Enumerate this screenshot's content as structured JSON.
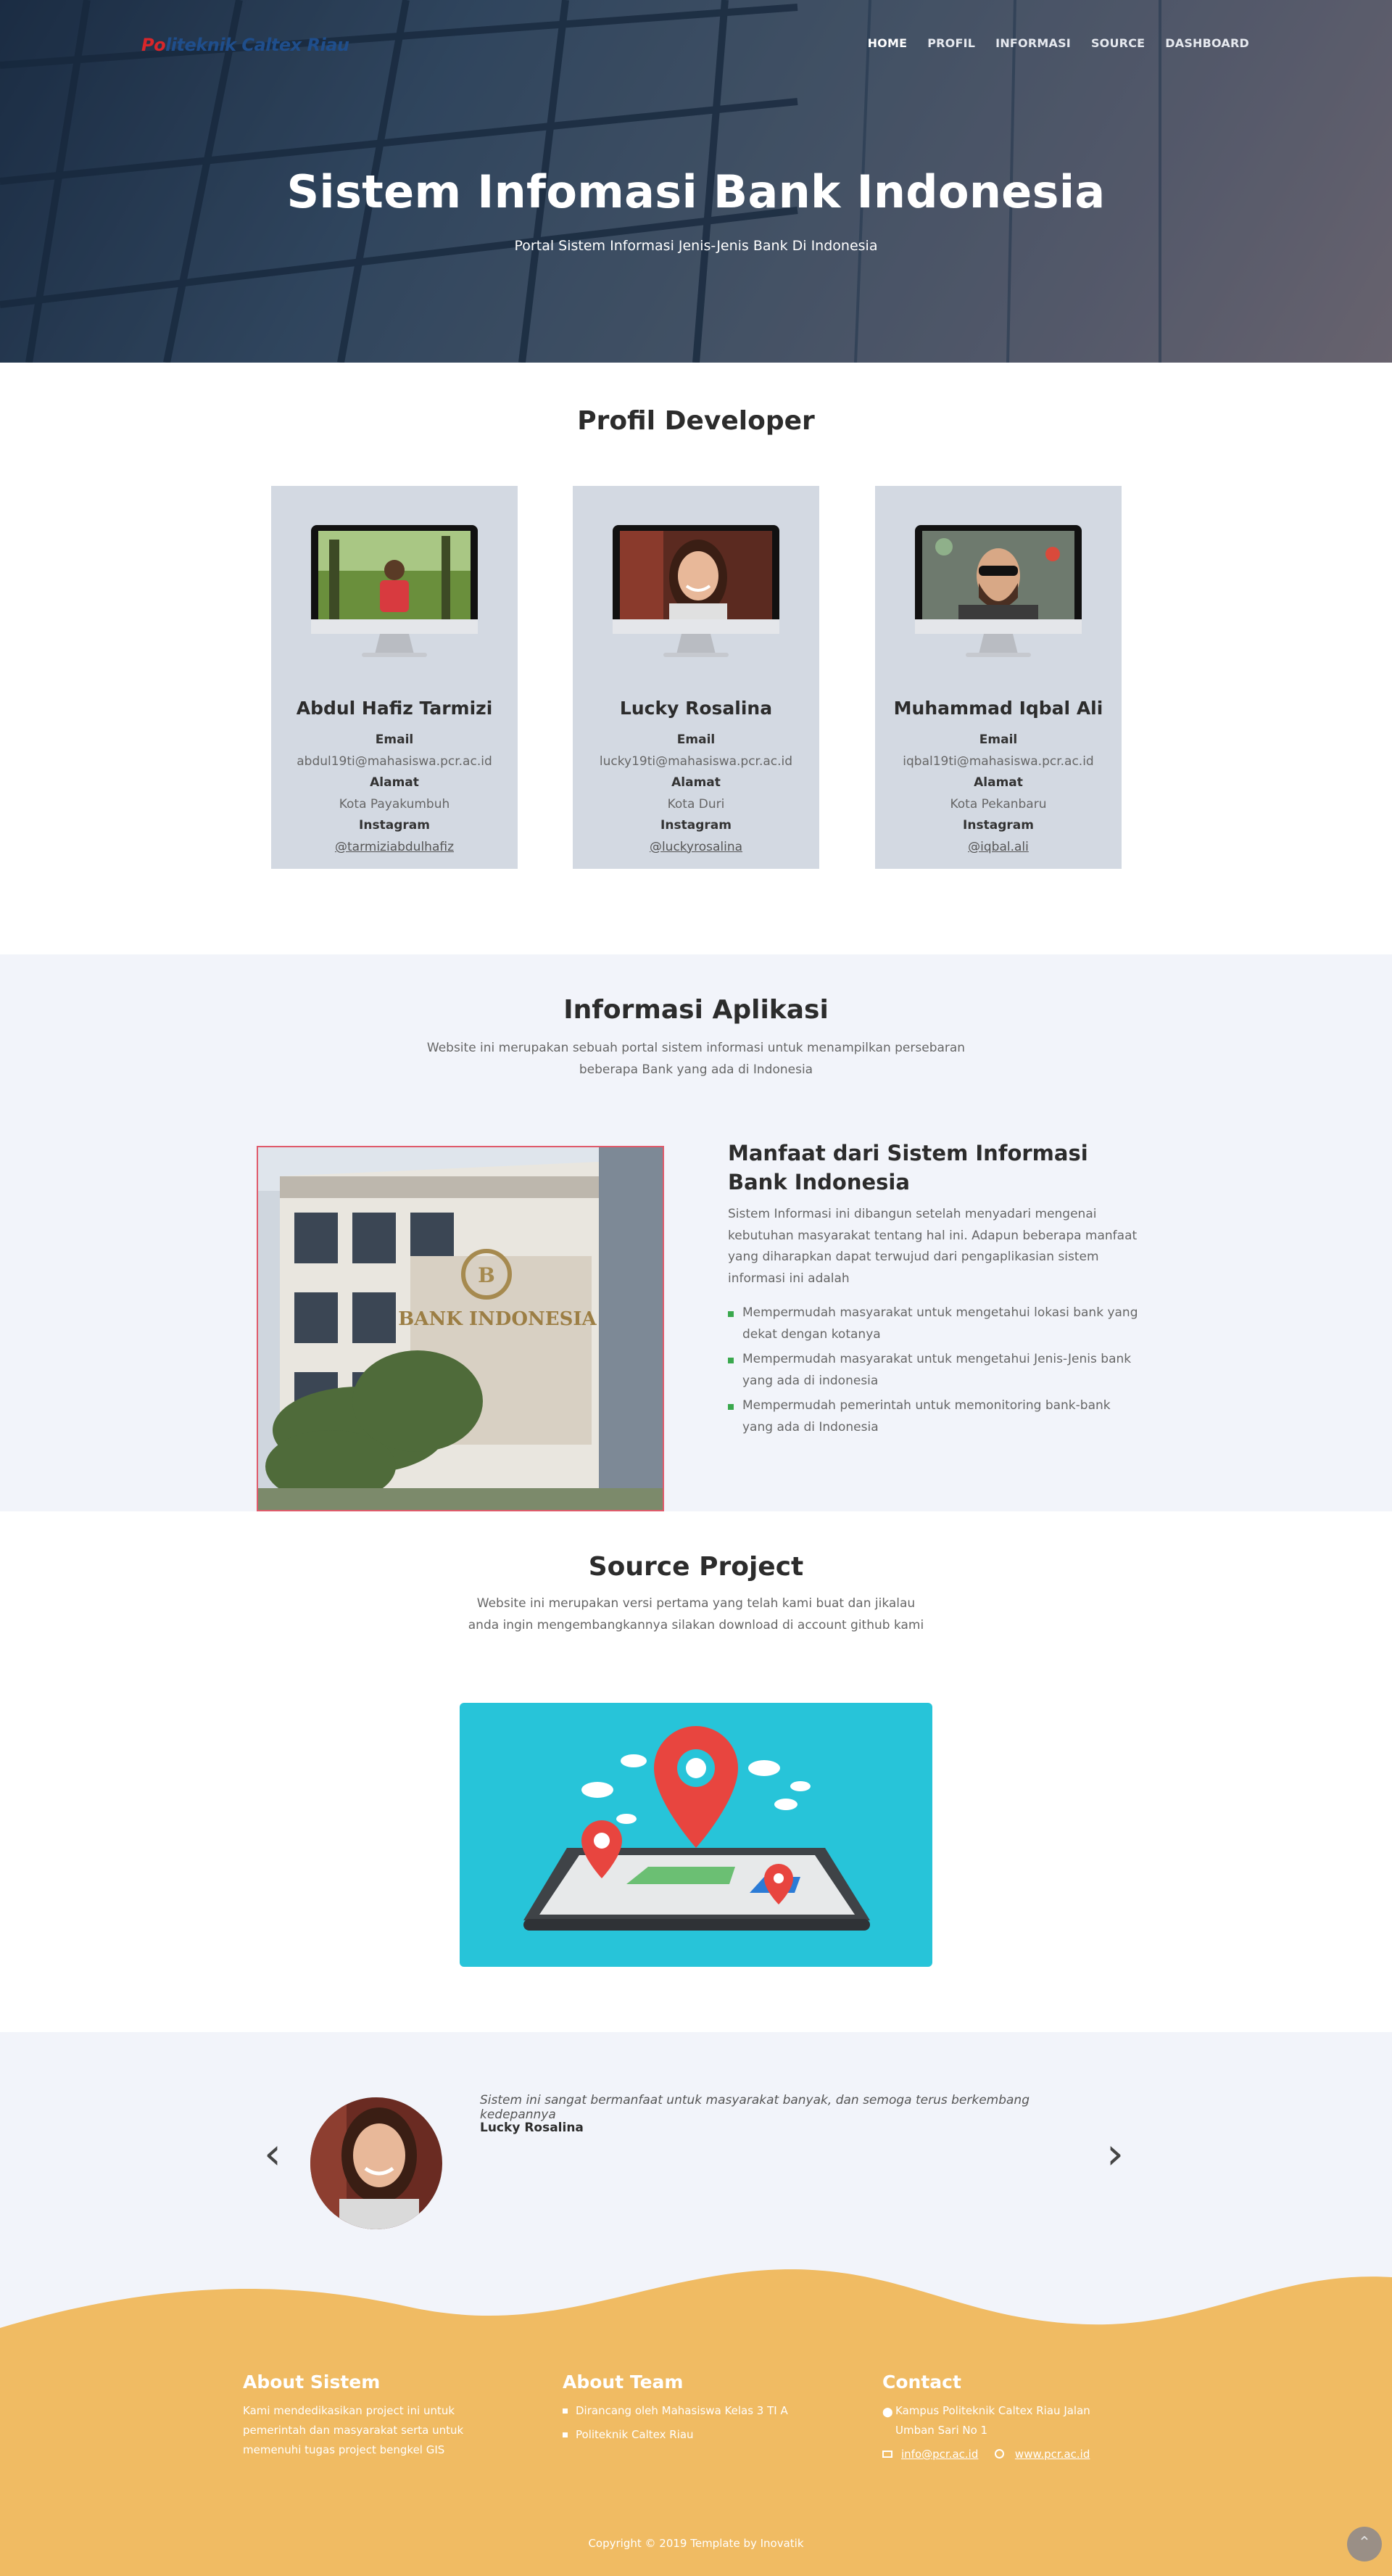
{
  "header": {
    "logo_part1": "Po",
    "logo_part2": "liteknik Caltex Riau",
    "nav": [
      "HOME",
      "PROFIL",
      "INFORMASI",
      "SOURCE",
      "DASHBOARD"
    ],
    "title": "Sistem Infomasi Bank Indonesia",
    "subtitle": "Portal Sistem Informasi Jenis-Jenis Bank Di Indonesia"
  },
  "profil": {
    "title": "Profil Developer",
    "cards": [
      {
        "name": "Abdul Hafiz Tarmizi",
        "email_label": "Email",
        "email": "abdul19ti@mahasiswa.pcr.ac.id",
        "alamat_label": "Alamat",
        "alamat": "Kota Payakumbuh",
        "instagram_label": "Instagram",
        "instagram": "@tarmiziabdulhafiz"
      },
      {
        "name": "Lucky Rosalina",
        "email_label": "Email",
        "email": "lucky19ti@mahasiswa.pcr.ac.id",
        "alamat_label": "Alamat",
        "alamat": "Kota Duri",
        "instagram_label": "Instagram",
        "instagram": "@luckyrosalina"
      },
      {
        "name": "Muhammad Iqbal Ali",
        "email_label": "Email",
        "email": "iqbal19ti@mahasiswa.pcr.ac.id",
        "alamat_label": "Alamat",
        "alamat": "Kota Pekanbaru",
        "instagram_label": "Instagram",
        "instagram": "@iqbal.ali"
      }
    ]
  },
  "informasi": {
    "title": "Informasi Aplikasi",
    "desc_line1": "Website ini merupakan sebuah portal sistem informasi untuk menampilkan persebaran",
    "desc_line2": "beberapa Bank yang ada di Indonesia",
    "photo_sign": "BANK INDONESIA",
    "manfaat_title": "Manfaat dari Sistem Informasi Bank Indonesia",
    "manfaat_desc": "Sistem Informasi ini dibangun setelah menyadari mengenai kebutuhan masyarakat tentang hal ini. Adapun beberapa manfaat yang diharapkan dapat terwujud dari pengaplikasian sistem informasi ini adalah",
    "manfaat_list": [
      "Mempermudah masyarakat untuk mengetahui lokasi bank yang dekat dengan kotanya",
      "Mempermudah masyarakat untuk mengetahui Jenis-Jenis bank yang ada di indonesia",
      "Mempermudah pemerintah untuk memonitoring bank-bank yang ada di Indonesia"
    ]
  },
  "source": {
    "title": "Source Project",
    "desc_line1": "Website ini merupakan versi pertama yang telah kami buat dan jikalau",
    "desc_line2": "anda ingin mengembangkannya silakan download di account github kami"
  },
  "testimonial": {
    "quote": "Sistem ini sangat bermanfaat untuk masyarakat banyak, dan semoga terus berkembang kedepannya",
    "name": "Lucky Rosalina",
    "prev_icon": "‹",
    "next_icon": "›"
  },
  "footer": {
    "about_title": "About Sistem",
    "about_text": "Kami mendedikasikan project ini untuk pemerintah dan masyarakat serta untuk memenuhi tugas project bengkel GIS",
    "team_title": "About Team",
    "team_items": [
      "Dirancang oleh Mahasiswa Kelas 3 TI A",
      "Politeknik Caltex Riau"
    ],
    "contact_title": "Contact",
    "contact_address": "Kampus Politeknik Caltex Riau Jalan Umban Sari No 1",
    "contact_email": "info@pcr.ac.id",
    "contact_web": "www.pcr.ac.id",
    "copyright": "Copyright © 2019 Template by Inovatik",
    "back_top_icon": "⌃"
  },
  "colors": {
    "footer": "#f0bb63",
    "light_section": "#f2f4fa",
    "card": "#d3d9e2",
    "bullet": "#3aa84d",
    "source_bg": "#27c4d9"
  }
}
